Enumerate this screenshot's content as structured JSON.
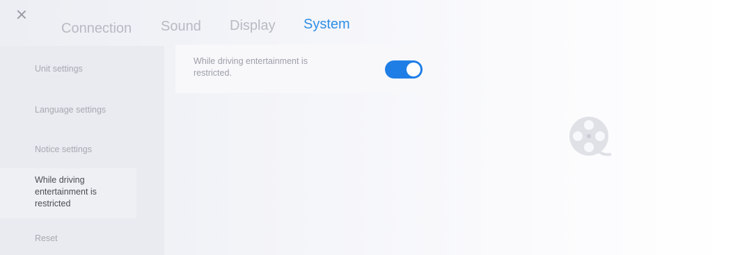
{
  "tabs": [
    {
      "label": "Connection",
      "active": false
    },
    {
      "label": "Sound",
      "active": false
    },
    {
      "label": "Display",
      "active": false
    },
    {
      "label": "System",
      "active": true
    }
  ],
  "sidebar": {
    "items": [
      {
        "label": "Unit settings",
        "active": false
      },
      {
        "label": "Language settings",
        "active": false
      },
      {
        "label": "Notice settings",
        "active": false
      },
      {
        "lines": [
          "While driving",
          "entertainment is",
          "restricted"
        ],
        "active": true
      },
      {
        "label": "Reset",
        "active": false
      }
    ]
  },
  "main": {
    "option_text_lines": [
      "While driving entertainment is",
      "restricted."
    ],
    "toggle_on": true
  },
  "colors": {
    "accent": "#2e8fe6",
    "toggle": "#1f7ee6",
    "inactive_text": "#b7bac3"
  },
  "icons": {
    "close": "close-icon",
    "placeholder": "film-reel-icon"
  }
}
